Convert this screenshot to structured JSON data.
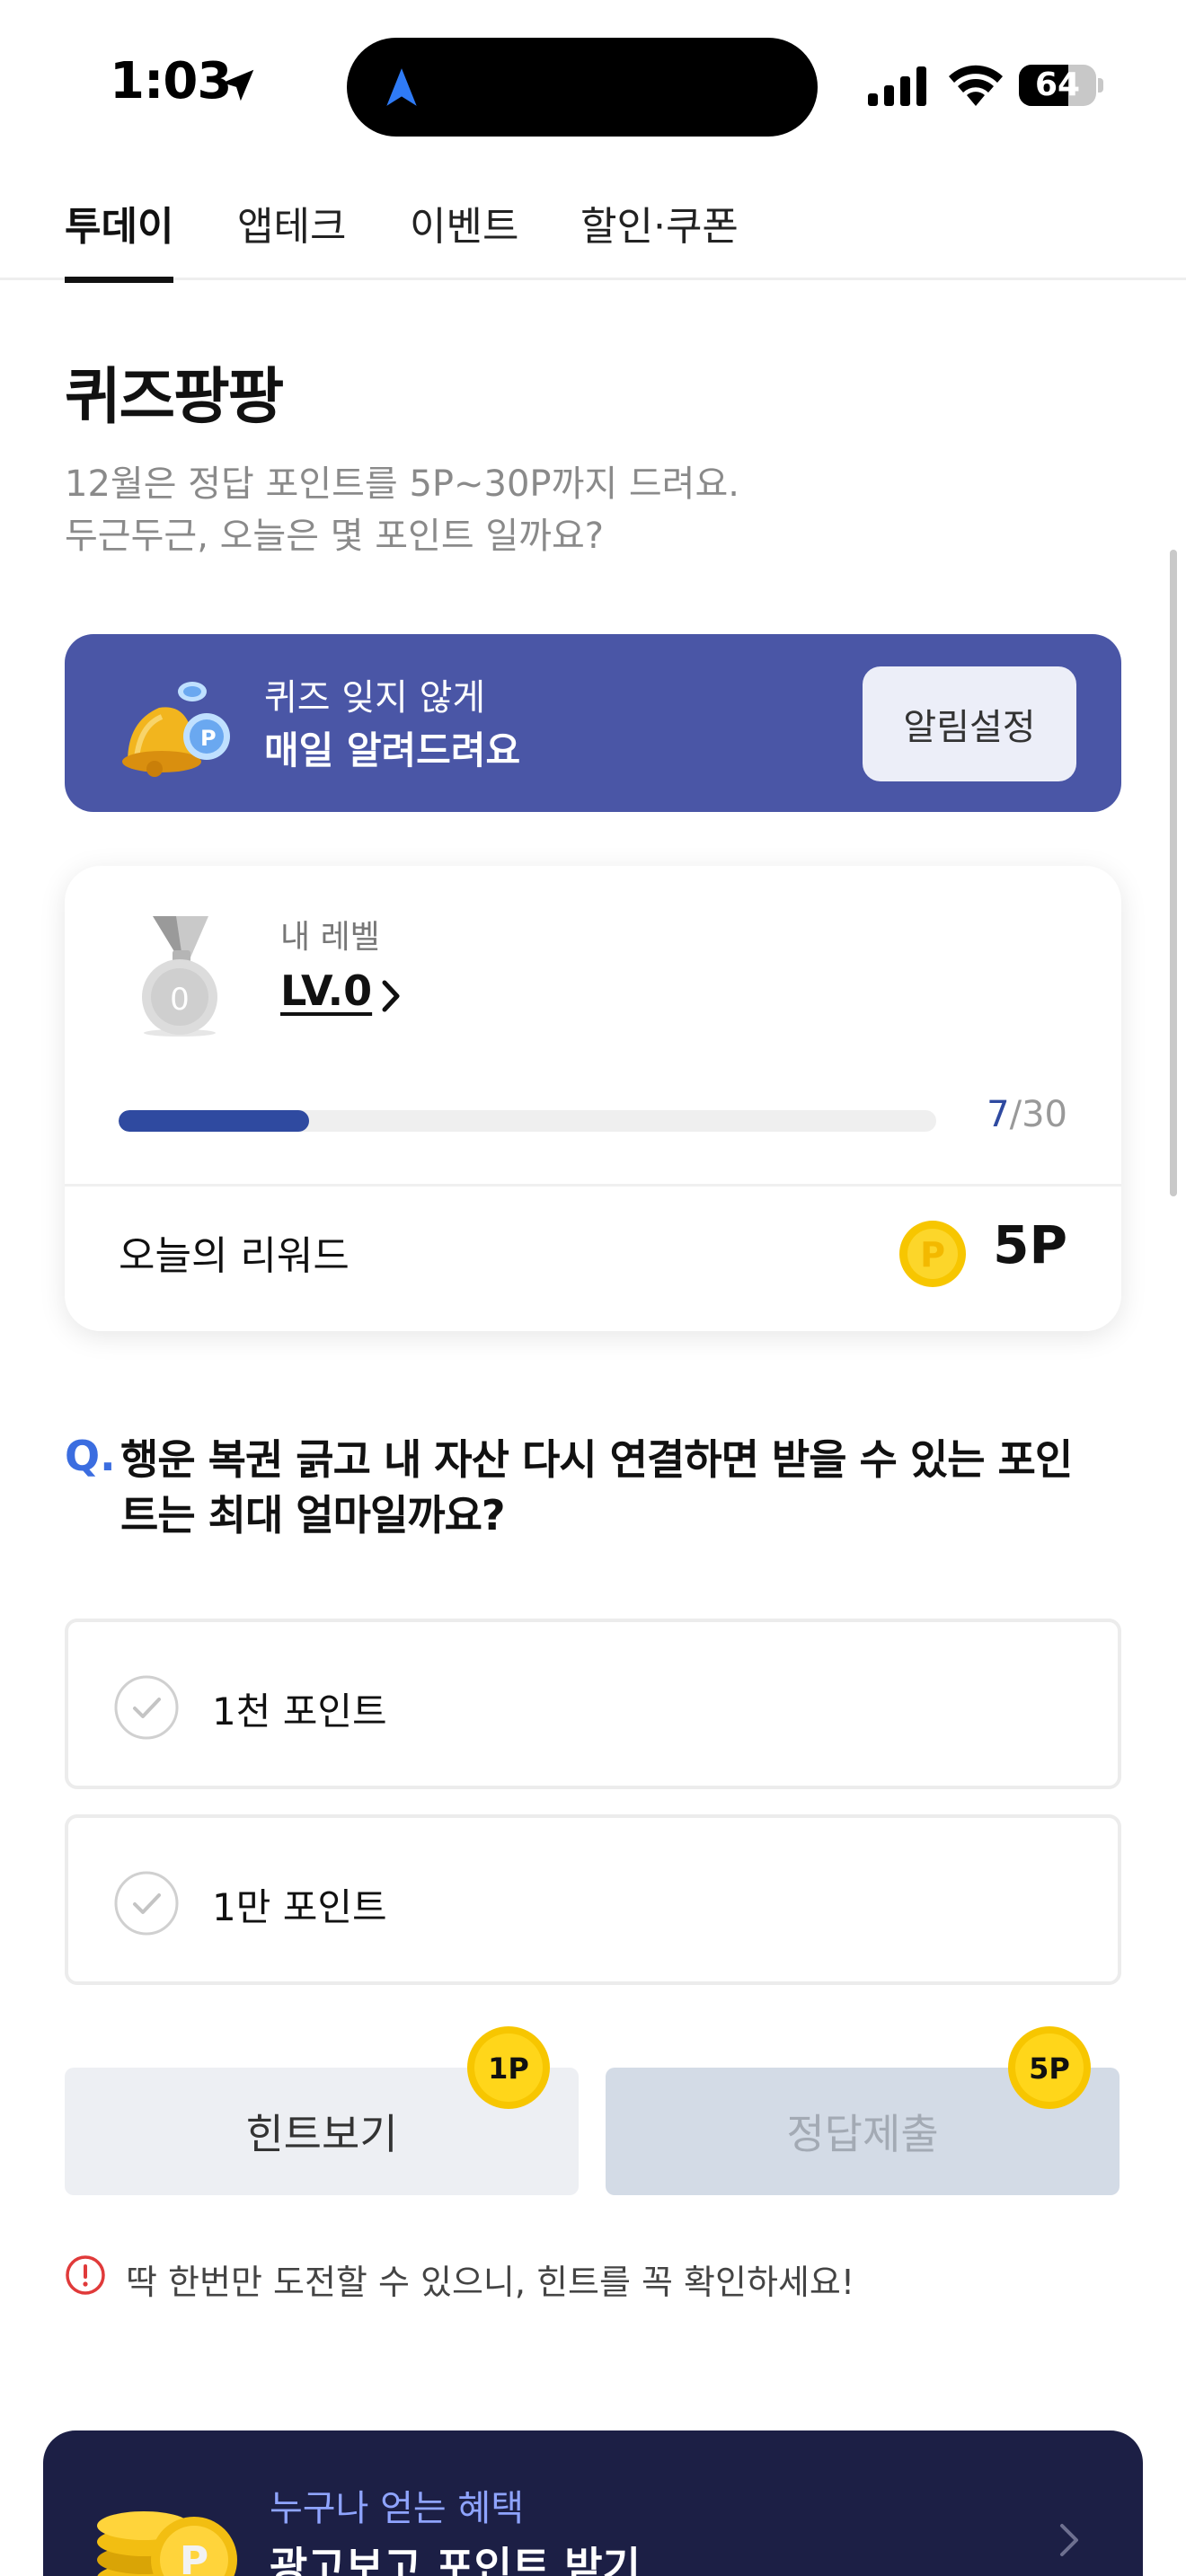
{
  "status_bar": {
    "time": "1:03",
    "battery_level": "64"
  },
  "tabs": [
    {
      "label": "투데이",
      "active": true
    },
    {
      "label": "앱테크",
      "active": false
    },
    {
      "label": "이벤트",
      "active": false
    },
    {
      "label": "할인·쿠폰",
      "active": false
    }
  ],
  "page": {
    "title": "퀴즈팡팡",
    "subtitle_line1": "12월은 정답 포인트를 5P~30P까지 드려요.",
    "subtitle_line2": "두근두근, 오늘은 몇 포인트 일까요?"
  },
  "banner": {
    "line1": "퀴즈 잊지 않게",
    "line2": "매일 알려드려요",
    "button_label": "알림설정"
  },
  "level_card": {
    "label": "내 레벨",
    "level": "LV.0",
    "medal_number": "0",
    "progress_current": "7",
    "progress_separator": "/",
    "progress_total": "30",
    "progress_fraction": 0.233,
    "reward_label": "오늘의 리워드",
    "reward_value": "5P"
  },
  "question": {
    "marker": "Q.",
    "text": "행운 복권 긁고 내 자산 다시 연결하면 받을 수 있는 포인트는 최대 얼마일까요?",
    "options": [
      {
        "label": "1천 포인트"
      },
      {
        "label": "1만 포인트"
      }
    ]
  },
  "actions": {
    "hint_label": "힌트보기",
    "hint_cost": "1P",
    "submit_label": "정답제출",
    "submit_reward": "5P"
  },
  "warning": "딱 한번만 도전할 수 있으니, 힌트를 꼭 확인하세요!",
  "promo": {
    "subtitle": "누구나 얻는 혜택",
    "title": "광고보고 포인트 받기"
  },
  "colors": {
    "accent": "#4a56a6",
    "progress": "#2f4aa0",
    "question_marker": "#3b6de0",
    "promo_bg": "#1c1f45",
    "coin": "#f7c600"
  }
}
